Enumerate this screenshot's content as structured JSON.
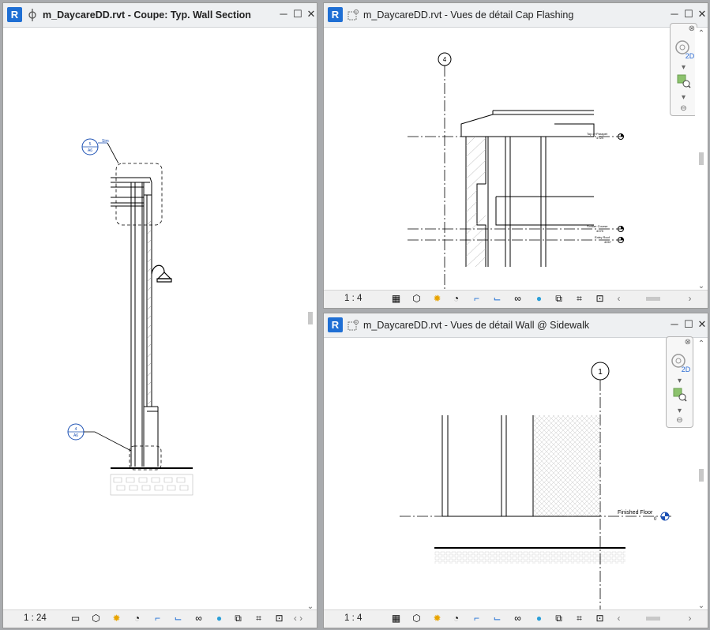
{
  "windows": {
    "left": {
      "title": "m_DaycareDD.rvt - Coupe: Typ. Wall Section",
      "scale": "1 : 24",
      "tags": [
        {
          "top": "5",
          "bottom": "A6",
          "label": "Sim"
        },
        {
          "top": "4",
          "bottom": "A6"
        }
      ]
    },
    "top_right": {
      "title": "m_DaycareDD.rvt - Vues de détail Cap Flashing",
      "scale": "1 : 4",
      "grid_label": "4",
      "levels": [
        {
          "name": "Top of Parapet",
          "value": "4724"
        },
        {
          "name": "Soldier Course",
          "value": "4375"
        },
        {
          "name": "Entry Roof",
          "value": "4267"
        }
      ]
    },
    "bottom_right": {
      "title": "m_DaycareDD.rvt - Vues de détail Wall @ Sidewalk",
      "scale": "1 : 4",
      "grid_label": "1",
      "level": {
        "name": "Finished Floor",
        "value": "0"
      }
    }
  },
  "nav_2d_label": "2D",
  "app_letter": "R",
  "colors": {
    "revit_blue": "#1f6fd4",
    "tag_blue": "#1a4fb3",
    "light_blue_icon": "#2a9fd8"
  }
}
